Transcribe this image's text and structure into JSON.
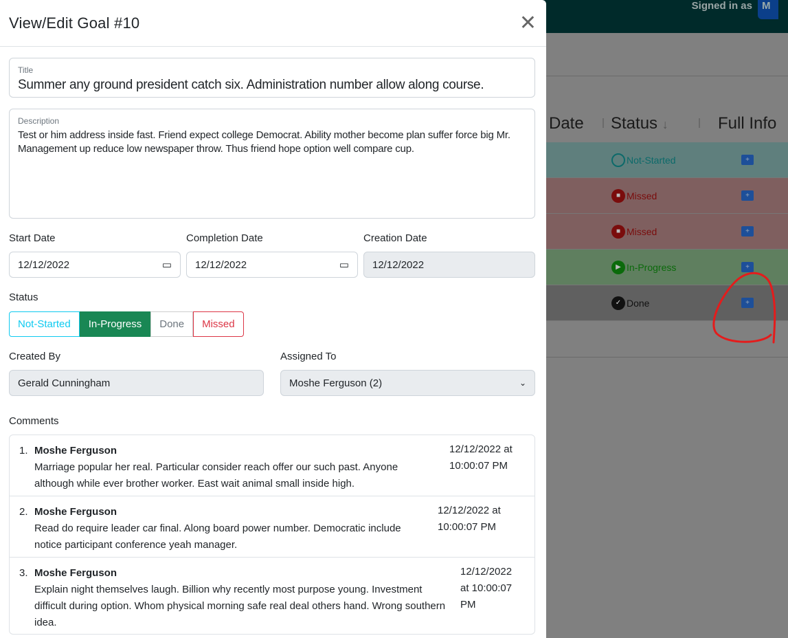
{
  "background": {
    "signed_in_label": "Signed in as",
    "user_button": "M",
    "columns": [
      "Date",
      "Status",
      "Full Info"
    ],
    "sort_icon": "arrow-down-icon",
    "rows": [
      {
        "status": "Not-Started",
        "color": "#5f7f7d",
        "text_color": "#0c6a6a"
      },
      {
        "status": "Missed",
        "color": "#7f5f5f",
        "text_color": "#7a0c0c"
      },
      {
        "status": "Missed",
        "color": "#7f5f5f",
        "text_color": "#7a0c0c"
      },
      {
        "status": "In-Progress",
        "color": "#5f7f5f",
        "text_color": "#0b6a0b"
      },
      {
        "status": "Done",
        "color": "#606060",
        "text_color": "#111111"
      }
    ]
  },
  "modal": {
    "title": "View/Edit Goal #10",
    "title_label": "Title",
    "title_value": "Summer any ground president catch six. Administration number allow along course.",
    "description_label": "Description",
    "description_lines": [
      "Test or him address inside fast. Friend expect college Democrat. Ability mother become plan suffer force big Mr.",
      "Management up reduce low newspaper throw. Thus friend hope option well compare cup."
    ],
    "start_date_label": "Start Date",
    "start_date": "12/12/2022",
    "completion_date_label": "Completion Date",
    "completion_date": "12/12/2022",
    "creation_date_label": "Creation Date",
    "creation_date": "12/12/2022",
    "status_label": "Status",
    "status_options": [
      "Not-Started",
      "In-Progress",
      "Done",
      "Missed"
    ],
    "status_selected": "In-Progress",
    "created_by_label": "Created By",
    "created_by": "Gerald Cunningham",
    "assigned_to_label": "Assigned To",
    "assigned_to": "Moshe Ferguson (2)",
    "comments_label": "Comments",
    "comments": [
      {
        "num": "1.",
        "author": "Moshe Ferguson",
        "text": "Marriage popular her real. Particular consider reach offer our such past. Anyone although while ever brother worker. East wait animal small inside high.",
        "date": "12/12/2022 at 10:00:07 PM"
      },
      {
        "num": "2.",
        "author": "Moshe Ferguson",
        "text": "Read do require leader car final. Along board power number. Democratic include notice participant conference yeah manager.",
        "date": "12/12/2022 at 10:00:07 PM"
      },
      {
        "num": "3.",
        "author": "Moshe Ferguson",
        "text": "Explain night themselves laugh. Billion why recently most purpose young. Investment difficult during option. Whom physical morning safe real deal others hand. Wrong southern idea.",
        "date": "12/12/2022 at 10:00:07 PM"
      }
    ]
  }
}
